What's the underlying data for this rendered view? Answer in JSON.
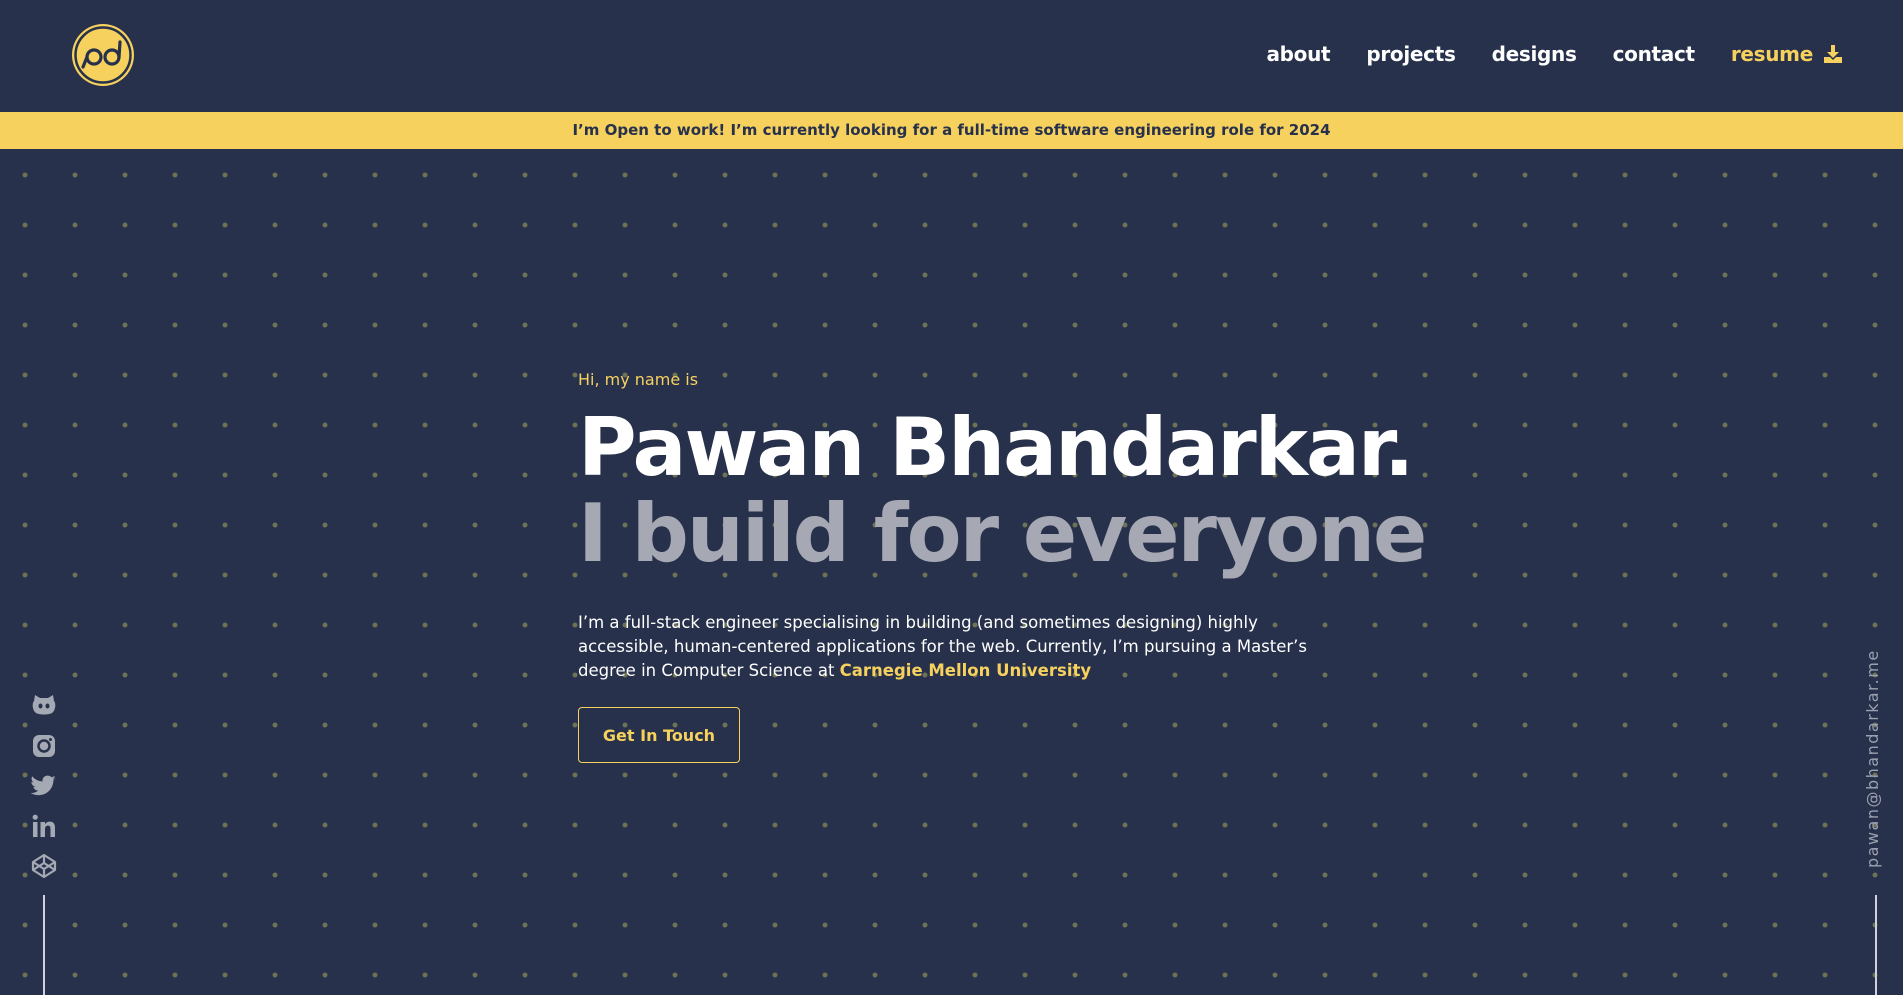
{
  "colors": {
    "background": "#27314b",
    "accent": "#f6d15e",
    "text": "#ffffff",
    "muted": "#a6a9b4"
  },
  "header": {
    "logo_icon": "pb-glasses-logo-icon",
    "nav": {
      "about": "about",
      "projects": "projects",
      "designs": "designs",
      "contact": "contact",
      "resume": "resume"
    },
    "resume_icon": "download-icon"
  },
  "banner": {
    "text": "I’m Open to work! I’m currently looking for a full-time software engineering role for 2024"
  },
  "hero": {
    "greeting": "Hi, my name is",
    "name": "Pawan Bhandarkar.",
    "tagline": "I build for everyone",
    "intro_before": "I’m a full-stack engineer specialising in building (and sometimes designing) highly accessible, human-centered applications for the web. Currently, I’m pursuing a Master’s degree in Computer Science at ",
    "university": "Carnegie Mellon University",
    "cta": "Get In Touch"
  },
  "socials": [
    {
      "icon": "github-icon"
    },
    {
      "icon": "instagram-icon"
    },
    {
      "icon": "twitter-icon"
    },
    {
      "icon": "linkedin-icon"
    },
    {
      "icon": "codepen-icon"
    }
  ],
  "email": "pawan@bhandarkar.me"
}
